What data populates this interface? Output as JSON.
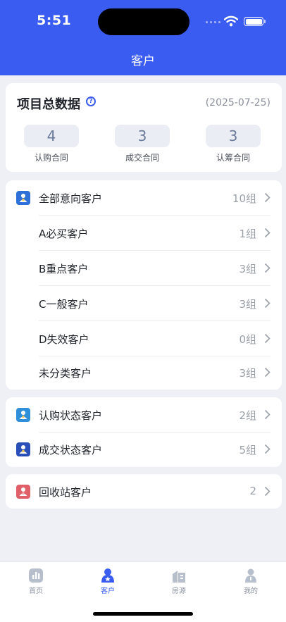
{
  "status_bar": {
    "time": "5:51"
  },
  "header": {
    "title": "客户"
  },
  "stats": {
    "title": "项目总数据",
    "date": "(2025-07-25)",
    "items": [
      {
        "value": "4",
        "label": "认购合同"
      },
      {
        "value": "3",
        "label": "成交合同"
      },
      {
        "value": "3",
        "label": "认筹合同"
      }
    ]
  },
  "intent_group": {
    "main": {
      "label": "全部意向客户",
      "count": "10组",
      "icon": "customer-icon",
      "color": "#2f6fd8"
    },
    "items": [
      {
        "label": "A必买客户",
        "count": "1组"
      },
      {
        "label": "B重点客户",
        "count": "3组"
      },
      {
        "label": "C一般客户",
        "count": "3组"
      },
      {
        "label": "D失效客户",
        "count": "0组"
      },
      {
        "label": "未分类客户",
        "count": "3组"
      }
    ]
  },
  "status_group": {
    "items": [
      {
        "label": "认购状态客户",
        "count": "2组",
        "icon": "customer-icon",
        "color": "#2f8fd8"
      },
      {
        "label": "成交状态客户",
        "count": "5组",
        "icon": "customer-icon",
        "color": "#2a4fb8"
      }
    ]
  },
  "recycle": {
    "label": "回收站客户",
    "count": "2",
    "icon": "customer-icon",
    "color": "#e0606a"
  },
  "tabs": [
    {
      "label": "首页",
      "icon": "chart-icon"
    },
    {
      "label": "客户",
      "icon": "customer-icon"
    },
    {
      "label": "房源",
      "icon": "building-icon"
    },
    {
      "label": "我的",
      "icon": "person-icon"
    }
  ],
  "colors": {
    "accent": "#3a5cf0",
    "background": "#eef0f5"
  }
}
